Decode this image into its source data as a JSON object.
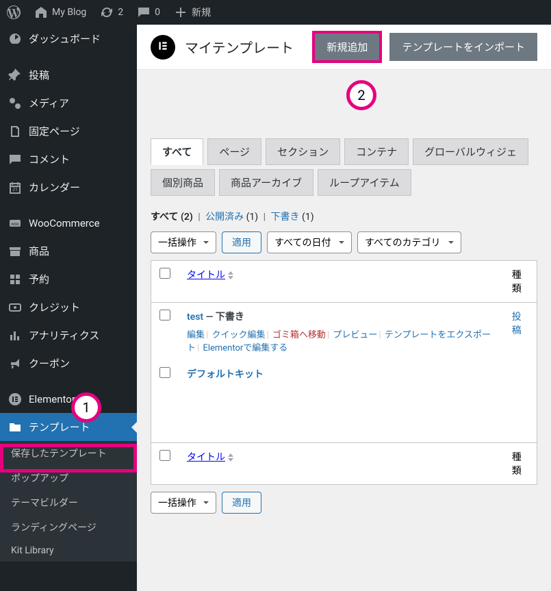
{
  "adminbar": {
    "site_name": "My Blog",
    "updates_count": "2",
    "comments_count": "0",
    "new_label": "新規"
  },
  "sidebar": {
    "items": [
      {
        "label": "ダッシュボード"
      },
      {
        "label": "投稿"
      },
      {
        "label": "メディア"
      },
      {
        "label": "固定ページ"
      },
      {
        "label": "コメント"
      },
      {
        "label": "カレンダー"
      },
      {
        "label": "WooCommerce"
      },
      {
        "label": "商品"
      },
      {
        "label": "予約"
      },
      {
        "label": "クレジット"
      },
      {
        "label": "アナリティクス"
      },
      {
        "label": "クーポン"
      },
      {
        "label": "Elementor"
      },
      {
        "label": "テンプレート"
      }
    ],
    "submenu": [
      {
        "label": "保存したテンプレート"
      },
      {
        "label": "ポップアップ"
      },
      {
        "label": "テーマビルダー"
      },
      {
        "label": "ランディングページ"
      },
      {
        "label": "Kit Library"
      }
    ]
  },
  "header": {
    "title": "マイテンプレート",
    "add_new": "新規追加",
    "import": "テンプレートをインポート"
  },
  "filter_tabs": [
    "すべて",
    "ページ",
    "セクション",
    "コンテナ",
    "グローバルウィジェ",
    "個別商品",
    "商品アーカイブ",
    "ループアイテム"
  ],
  "subsubsub": {
    "all_label": "すべて",
    "all_count": "(2)",
    "published_label": "公開済み",
    "published_count": "(1)",
    "draft_label": "下書き",
    "draft_count": "(1)"
  },
  "bulk": {
    "placeholder": "一括操作",
    "apply": "適用",
    "dates": "すべての日付",
    "categories": "すべてのカテゴリ"
  },
  "columns": {
    "title": "タイトル",
    "type": "種類"
  },
  "rows": [
    {
      "title": "test",
      "state": "— 下書き",
      "type": "投稿",
      "actions": {
        "edit": "編集",
        "quick_edit": "クイック編集",
        "trash": "ゴミ箱へ移動",
        "preview": "プレビュー",
        "export": "テンプレートをエクスポート",
        "edit_elementor": "Elementorで編集する"
      }
    },
    {
      "title": "デフォルトキット",
      "state": "",
      "type": ""
    }
  ],
  "annotations": {
    "badge1": "1",
    "badge2": "2"
  },
  "colors": {
    "highlight": "#e6007e",
    "wp_blue": "#2271b1"
  }
}
